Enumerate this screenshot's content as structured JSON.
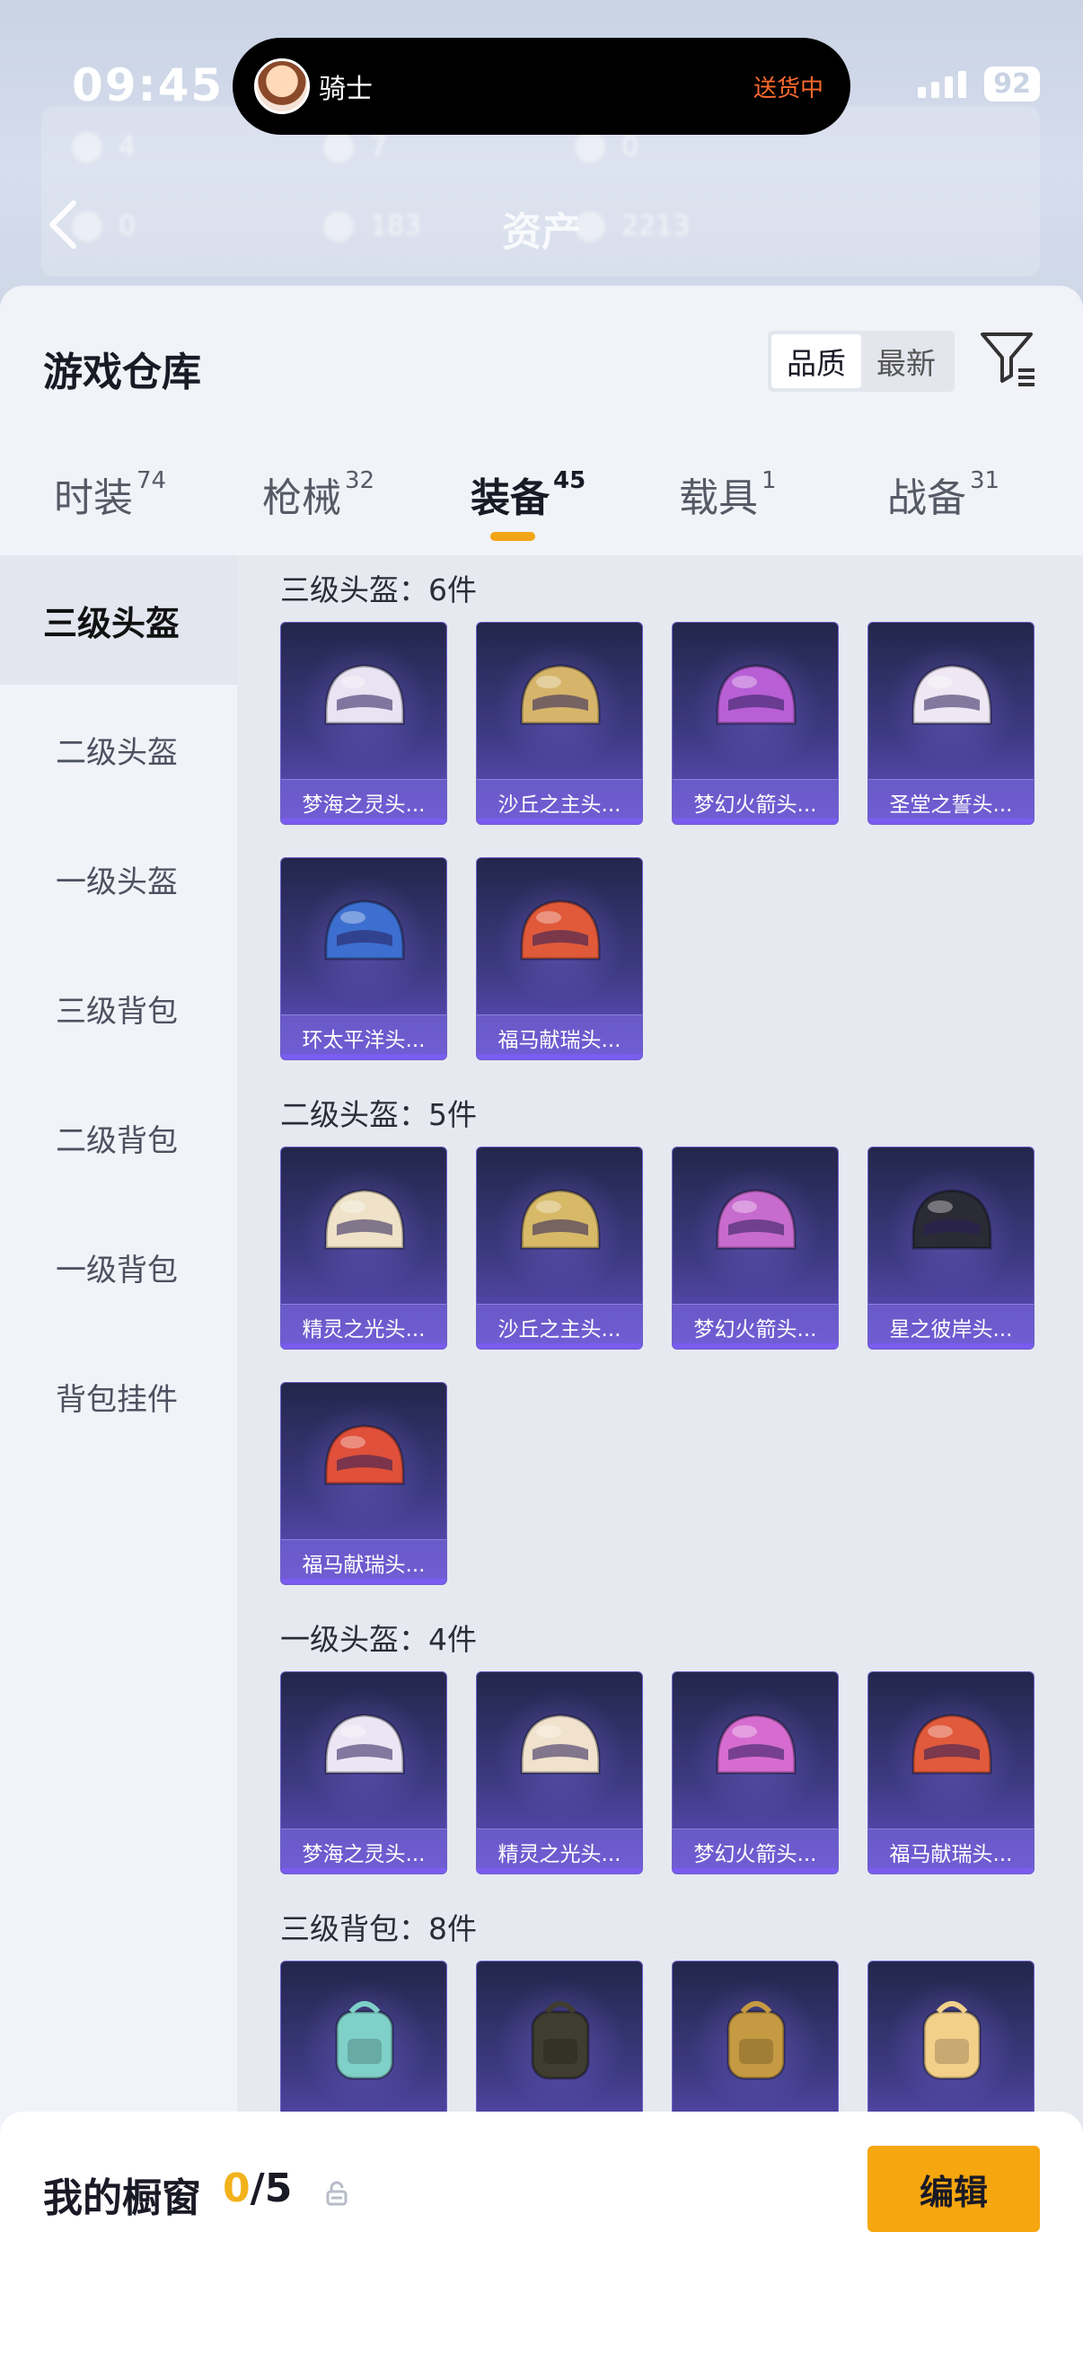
{
  "status_bar": {
    "time": "09:45",
    "battery": "92"
  },
  "island": {
    "name": "骑士",
    "status": "送货中"
  },
  "header": {
    "title": "资产"
  },
  "warehouse": {
    "title": "游戏仓库",
    "sort_options": [
      "品质",
      "最新"
    ],
    "active_sort": "品质"
  },
  "tabs": [
    {
      "label": "时装",
      "count": "74"
    },
    {
      "label": "枪械",
      "count": "32"
    },
    {
      "label": "装备",
      "count": "45",
      "active": true
    },
    {
      "label": "载具",
      "count": "1"
    },
    {
      "label": "战备",
      "count": "31"
    }
  ],
  "sidebar": {
    "items": [
      {
        "label": "三级头盔",
        "active": true
      },
      {
        "label": "二级头盔"
      },
      {
        "label": "一级头盔"
      },
      {
        "label": "三级背包"
      },
      {
        "label": "二级背包"
      },
      {
        "label": "一级背包"
      },
      {
        "label": "背包挂件"
      }
    ]
  },
  "sections": [
    {
      "title": "三级头盔：6件",
      "items": [
        {
          "name": "梦海之灵头...",
          "icon": "helmet-icon",
          "color": "#e9e3f3"
        },
        {
          "name": "沙丘之主头...",
          "icon": "helmet-icon",
          "color": "#d6b56b"
        },
        {
          "name": "梦幻火箭头...",
          "icon": "helmet-icon",
          "color": "#b85fd6"
        },
        {
          "name": "圣堂之誓头...",
          "icon": "helmet-icon",
          "color": "#efe8f4"
        },
        {
          "name": "环太平洋头...",
          "icon": "helmet-icon",
          "color": "#3d6fd0"
        },
        {
          "name": "福马献瑞头...",
          "icon": "helmet-icon",
          "color": "#e05a3a"
        }
      ]
    },
    {
      "title": "二级头盔：5件",
      "items": [
        {
          "name": "精灵之光头...",
          "icon": "helmet-icon",
          "color": "#efe2c8"
        },
        {
          "name": "沙丘之主头...",
          "icon": "helmet-icon",
          "color": "#d7b968"
        },
        {
          "name": "梦幻火箭头...",
          "icon": "helmet-icon",
          "color": "#c86bcf"
        },
        {
          "name": "星之彼岸头...",
          "icon": "helmet-icon",
          "color": "#2b2b35"
        },
        {
          "name": "福马献瑞头...",
          "icon": "helmet-icon",
          "color": "#e0503a"
        }
      ]
    },
    {
      "title": "一级头盔：4件",
      "items": [
        {
          "name": "梦海之灵头...",
          "icon": "helmet-icon",
          "color": "#ece6f4"
        },
        {
          "name": "精灵之光头...",
          "icon": "helmet-icon",
          "color": "#f0e2cd"
        },
        {
          "name": "梦幻火箭头...",
          "icon": "helmet-icon",
          "color": "#d66cd0"
        },
        {
          "name": "福马献瑞头...",
          "icon": "helmet-icon",
          "color": "#e25a3c"
        }
      ]
    },
    {
      "title": "三级背包：8件",
      "items": [
        {
          "name": "",
          "icon": "backpack-icon",
          "color": "#7fd0c8"
        },
        {
          "name": "",
          "icon": "backpack-icon",
          "color": "#3f3d2f"
        },
        {
          "name": "",
          "icon": "backpack-icon",
          "color": "#c59a42"
        },
        {
          "name": "",
          "icon": "backpack-icon",
          "color": "#f2d08a"
        }
      ]
    }
  ],
  "showcase": {
    "label": "我的橱窗",
    "current": "0",
    "separator": "/",
    "max": "5",
    "edit_label": "编辑"
  },
  "colors": {
    "accent": "#f6a60f",
    "count_highlight": "#f2b21b",
    "card_top": "#23264b",
    "card_bottom": "#6450c6",
    "delivery": "#ff6a2b"
  }
}
